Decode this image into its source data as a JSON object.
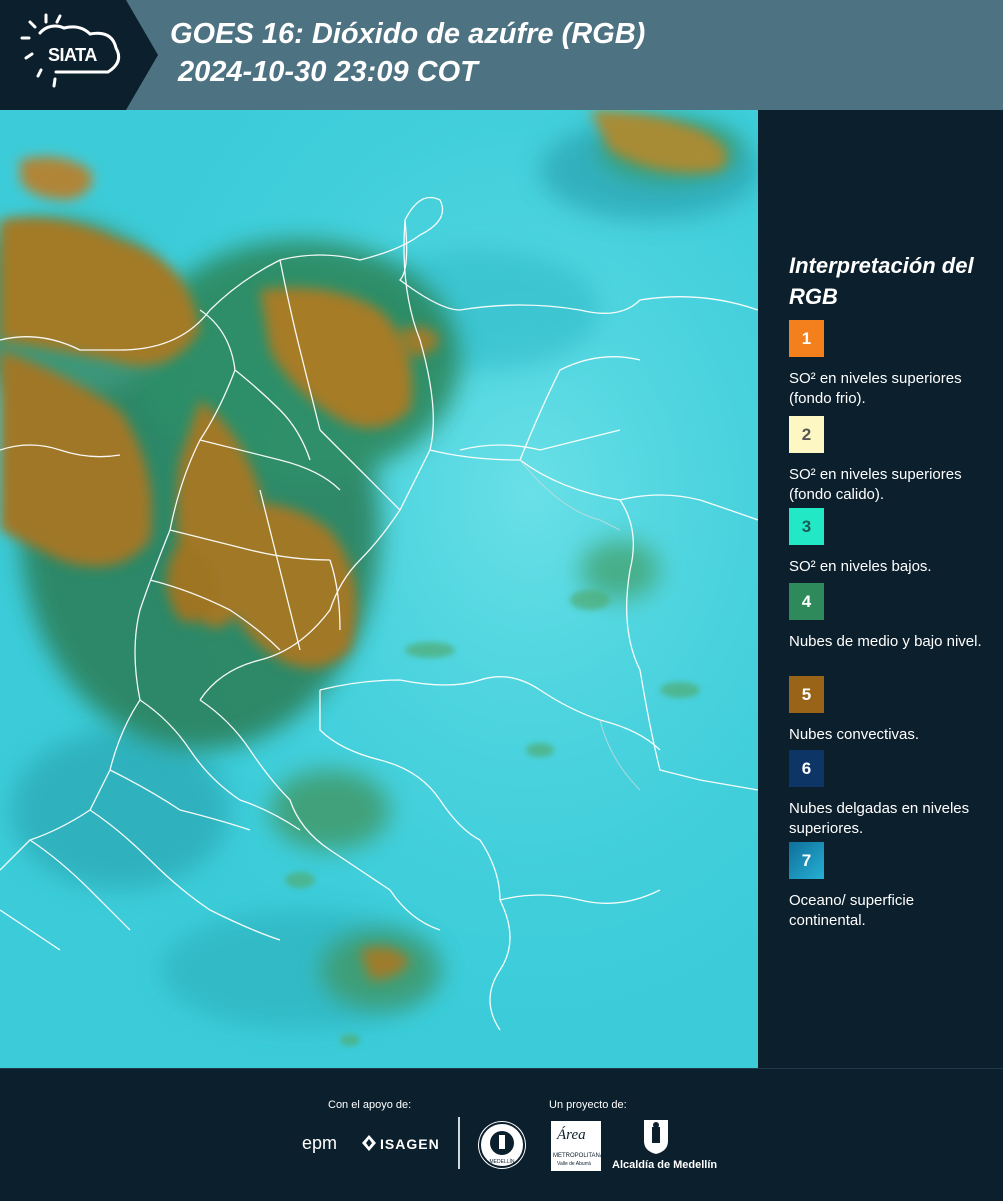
{
  "header": {
    "logo_text": "SIATA",
    "title": "GOES 16: Dióxido de azúfre (RGB)",
    "timestamp": "2024-10-30 23:09 COT",
    "bg_color": "#4d7281",
    "logo_bg_color": "#0c1f2c"
  },
  "map": {
    "description_icon": "satellite-rgb-map",
    "colors": {
      "background": "#3fd1de",
      "convective": "#a87b22",
      "green": "#2e8a4e",
      "borders": "#ffffff"
    }
  },
  "legend": {
    "title": "Interpretación del RGB",
    "items": [
      {
        "num": "1",
        "color": "#f4801d",
        "num_color": "#ffffff",
        "text": "SO² en niveles superiores (fondo frio)."
      },
      {
        "num": "2",
        "color": "#fdf7c4",
        "num_color": "#555555",
        "text": "SO² en niveles superiores (fondo calido)."
      },
      {
        "num": "3",
        "color": "#22e8c6",
        "num_color": "#1b5e56",
        "text": "SO² en niveles bajos."
      },
      {
        "num": "4",
        "color": "#2e8a5b",
        "num_color": "#ffffff",
        "text": "Nubes de medio y bajo nivel."
      },
      {
        "num": "5",
        "color": "#9a6418",
        "num_color": "#ffffff",
        "text": "Nubes convectivas."
      },
      {
        "num": "6",
        "color": "#0d3566",
        "num_color": "#ffffff",
        "text": "Nubes delgadas en niveles superiores."
      },
      {
        "num": "7",
        "color": "#1a8db8",
        "num_color": "#ffffff",
        "text": "Oceano/ superficie continental."
      }
    ]
  },
  "footer": {
    "support_label": "Con el apoyo de:",
    "support_brands": [
      "epm",
      "ISAGEN"
    ],
    "project_label": "Un proyecto de:",
    "project_brands": [
      "Área",
      "METROPOLITANA",
      "Valle de Aburrá",
      "Alcaldía de Medellín",
      "MEDELLÍN"
    ]
  }
}
